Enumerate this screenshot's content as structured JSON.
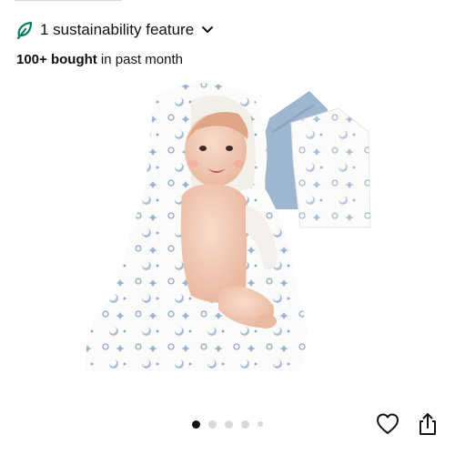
{
  "sustainability": {
    "label": "1 sustainability feature",
    "icon": "leaf-icon",
    "toggle_icon": "chevron-down-icon",
    "accent": "#067D62"
  },
  "purchase_stats": {
    "count": "100+ bought",
    "suffix": " in past month"
  },
  "gallery": {
    "image": "baby-hooded-towel-photo",
    "thumbnail": "towel-colors-inset",
    "image_count": 5,
    "active_index": 0
  },
  "actions": {
    "favorite_icon": "heart-icon",
    "share_icon": "share-icon"
  }
}
